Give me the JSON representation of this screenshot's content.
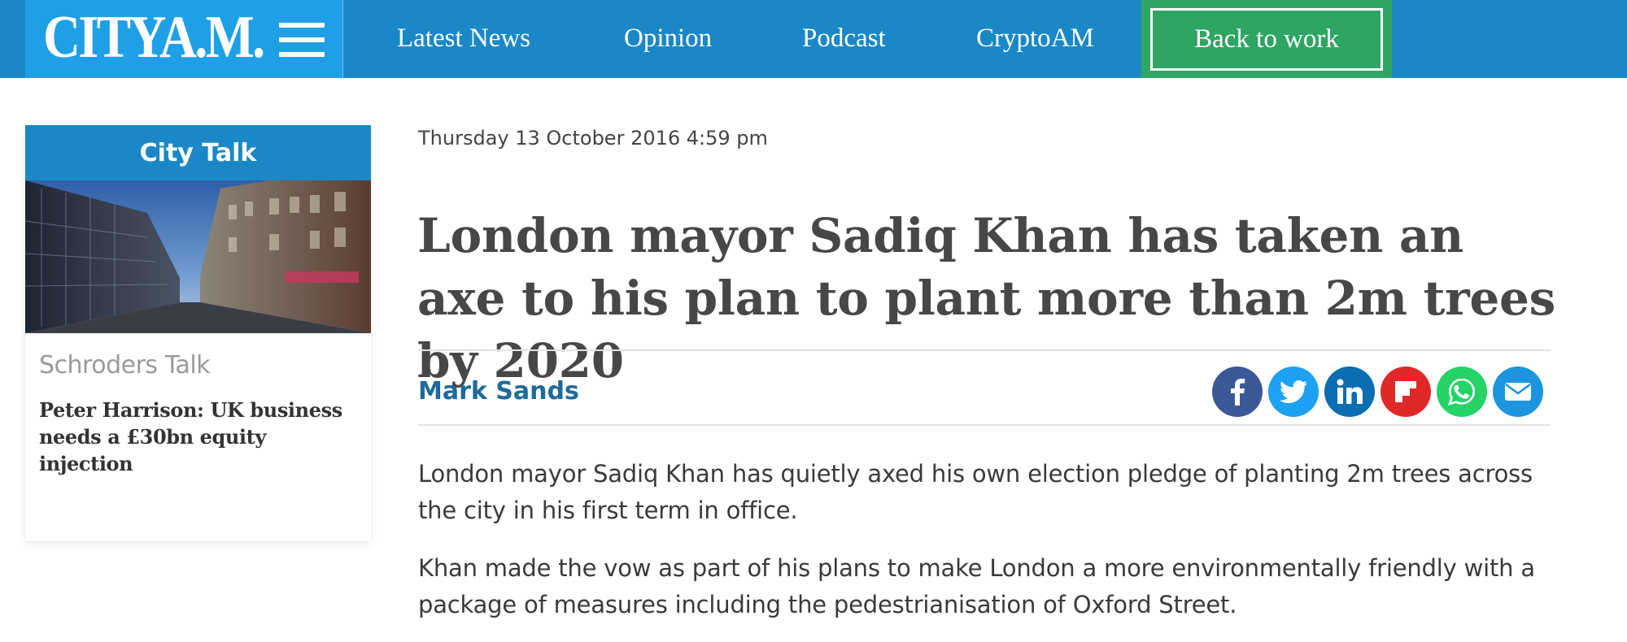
{
  "nav": {
    "logo": "CITYA.M.",
    "items": [
      "Latest News",
      "Opinion",
      "Podcast",
      "CryptoAM"
    ],
    "cta": "Back to work",
    "colors": {
      "bar": "#1a88c6",
      "logo_bg": "#1fa0e6",
      "cta": "#2fa564"
    }
  },
  "sidebar": {
    "header": "City Talk",
    "sponsor": "Schroders Talk",
    "headline": "Peter Harrison: UK business needs a £30bn equity injection"
  },
  "article": {
    "timestamp": "Thursday 13 October 2016 4:59 pm",
    "headline": "London mayor Sadiq Khan has taken an axe to his plan to plant more than 2m trees by 2020",
    "author": "Mark Sands",
    "share_icons": [
      "facebook-icon",
      "twitter-icon",
      "linkedin-icon",
      "flipboard-icon",
      "whatsapp-icon",
      "email-icon"
    ],
    "paragraphs": [
      "London mayor Sadiq Khan has quietly axed his own election pledge of planting 2m trees across the city in his first term in office.",
      "Khan made the vow as part of his plans to make London a more environmentally friendly with a package of measures including the pedestrianisation of Oxford Street."
    ]
  }
}
